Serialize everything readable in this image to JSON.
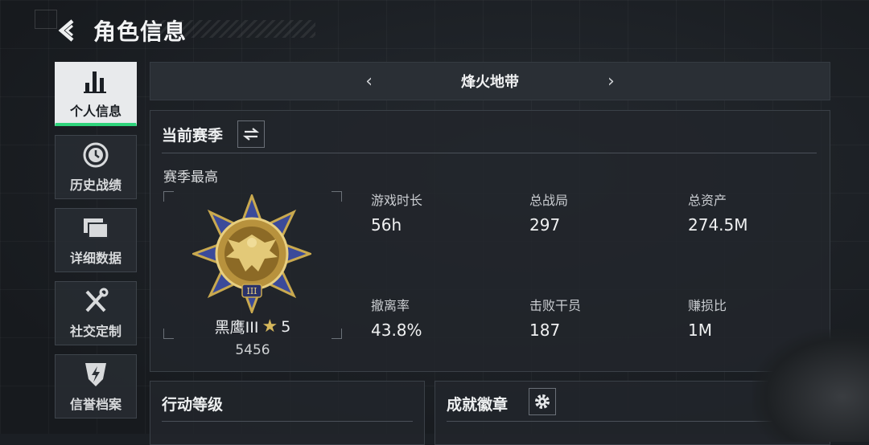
{
  "header": {
    "title": "角色信息"
  },
  "sidebar": {
    "items": [
      {
        "label": "个人信息",
        "icon": "bar-chart-icon",
        "active": true
      },
      {
        "label": "历史战绩",
        "icon": "history-clock-icon",
        "active": false
      },
      {
        "label": "详细数据",
        "icon": "folder-icon",
        "active": false
      },
      {
        "label": "社交定制",
        "icon": "tools-icon",
        "active": false
      },
      {
        "label": "信誉档案",
        "icon": "shield-bolt-icon",
        "active": false
      }
    ]
  },
  "map_selector": {
    "name": "烽火地带",
    "prev": "‹",
    "next": "›"
  },
  "season": {
    "label": "当前赛季",
    "best_label": "赛季最高",
    "rank_name": "黑鹰III",
    "rank_stars": "5",
    "score": "5456",
    "medal_numeral": "III"
  },
  "stats": [
    {
      "label": "游戏时长",
      "value": "56h"
    },
    {
      "label": "总战局",
      "value": "297"
    },
    {
      "label": "总资产",
      "value": "274.5M"
    },
    {
      "label": "撤离率",
      "value": "43.8%"
    },
    {
      "label": "击败干员",
      "value": "187"
    },
    {
      "label": "赚损比",
      "value": "1M"
    }
  ],
  "bottom": {
    "level_title": "行动等级",
    "badges_title": "成就徽章"
  },
  "colors": {
    "accent": "#2fd47c",
    "gold": "#d6b85c",
    "medal_blue": "#3b4a9a"
  }
}
